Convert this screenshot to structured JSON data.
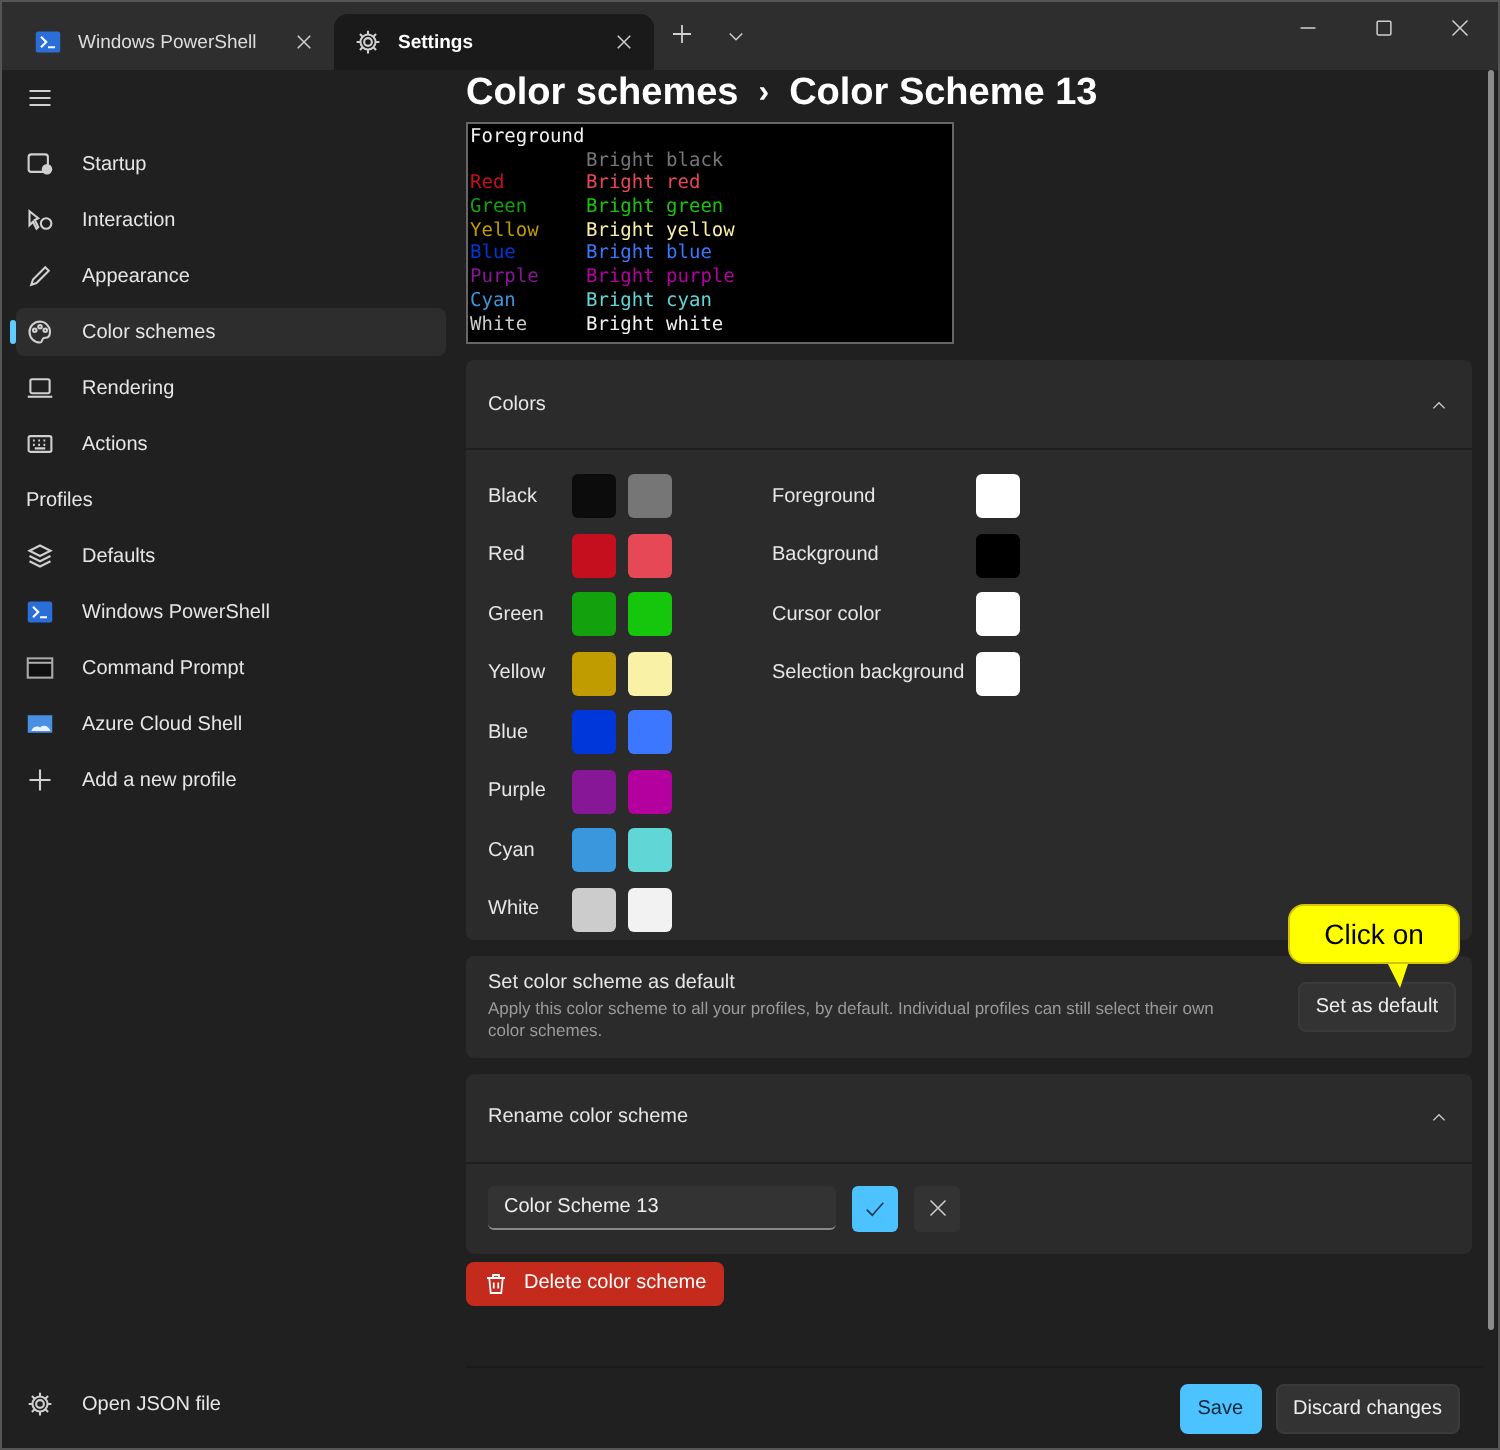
{
  "tabs": [
    {
      "label": "Windows PowerShell",
      "selected": false
    },
    {
      "label": "Settings",
      "selected": true
    }
  ],
  "breadcrumb": [
    "Color schemes",
    "›",
    "Color Scheme 13"
  ],
  "sidebar": {
    "items": [
      {
        "label": "Startup",
        "selected": false
      },
      {
        "label": "Interaction",
        "selected": false
      },
      {
        "label": "Appearance",
        "selected": false
      },
      {
        "label": "Color schemes",
        "selected": true
      },
      {
        "label": "Rendering",
        "selected": false
      },
      {
        "label": "Actions",
        "selected": false
      }
    ],
    "section": "Profiles",
    "profiles": [
      {
        "label": "Defaults",
        "selected": false
      },
      {
        "label": "Windows PowerShell",
        "selected": false
      },
      {
        "label": "Command Prompt",
        "selected": false
      },
      {
        "label": "Azure Cloud Shell",
        "selected": false
      },
      {
        "label": "Add a new profile",
        "selected": false
      }
    ],
    "footer": "Open JSON file"
  },
  "preview": {
    "rows": [
      {
        "left": {
          "text": "Foreground",
          "color": "#f2f2f2"
        }
      },
      {
        "right": {
          "text": "Bright black",
          "color": "#767676"
        }
      },
      {
        "left": {
          "text": "Red",
          "color": "#c50f1f"
        },
        "right": {
          "text": "Bright red",
          "color": "#e74856"
        }
      },
      {
        "left": {
          "text": "Green",
          "color": "#13a10e"
        },
        "right": {
          "text": "Bright green",
          "color": "#16c60c"
        }
      },
      {
        "left": {
          "text": "Yellow",
          "color": "#c19c00"
        },
        "right": {
          "text": "Bright yellow",
          "color": "#f9f1a5"
        }
      },
      {
        "left": {
          "text": "Blue",
          "color": "#0037da"
        },
        "right": {
          "text": "Bright blue",
          "color": "#3b78ff"
        }
      },
      {
        "left": {
          "text": "Purple",
          "color": "#881798"
        },
        "right": {
          "text": "Bright purple",
          "color": "#b4009e"
        }
      },
      {
        "left": {
          "text": "Cyan",
          "color": "#3a96dd"
        },
        "right": {
          "text": "Bright cyan",
          "color": "#61d6d6"
        }
      },
      {
        "left": {
          "text": "White",
          "color": "#cccccc"
        },
        "right": {
          "text": "Bright white",
          "color": "#f2f2f2"
        }
      }
    ]
  },
  "colors_panel": {
    "title": "Colors",
    "expanded": true,
    "palette": [
      {
        "label": "Black",
        "swatches": [
          {
            "color": "#0c0c0c"
          },
          {
            "color": "#767676"
          }
        ]
      },
      {
        "label": "Red",
        "swatches": [
          {
            "color": "#c50f1f"
          },
          {
            "color": "#e74856"
          }
        ]
      },
      {
        "label": "Green",
        "swatches": [
          {
            "color": "#13a10e"
          },
          {
            "color": "#16c60c"
          }
        ]
      },
      {
        "label": "Yellow",
        "swatches": [
          {
            "color": "#c19c00"
          },
          {
            "color": "#f9f1a5"
          }
        ]
      },
      {
        "label": "Blue",
        "swatches": [
          {
            "color": "#0037da"
          },
          {
            "color": "#3b78ff"
          }
        ]
      },
      {
        "label": "Purple",
        "swatches": [
          {
            "color": "#881798"
          },
          {
            "color": "#b4009e"
          }
        ]
      },
      {
        "label": "Cyan",
        "swatches": [
          {
            "color": "#3a96dd"
          },
          {
            "color": "#61d6d6"
          }
        ]
      },
      {
        "label": "White",
        "swatches": [
          {
            "color": "#cccccc"
          },
          {
            "color": "#f2f2f2"
          }
        ]
      }
    ],
    "system": [
      {
        "label": "Foreground",
        "color": "#ffffff"
      },
      {
        "label": "Background",
        "color": "#000000"
      },
      {
        "label": "Cursor color",
        "color": "#ffffff"
      },
      {
        "label": "Selection background",
        "color": "#ffffff"
      }
    ]
  },
  "default_card": {
    "title": "Set color scheme as default",
    "description": "Apply this color scheme to all your profiles, by default. Individual profiles can still select their own color schemes.",
    "button": "Set as default"
  },
  "callout": {
    "text": "Click on"
  },
  "rename": {
    "title": "Rename color scheme",
    "expanded": true,
    "value": "Color Scheme 13"
  },
  "delete_button": "Delete color scheme",
  "footer_buttons": [
    {
      "label": "Save",
      "primary": true
    },
    {
      "label": "Discard changes",
      "primary": false
    }
  ]
}
